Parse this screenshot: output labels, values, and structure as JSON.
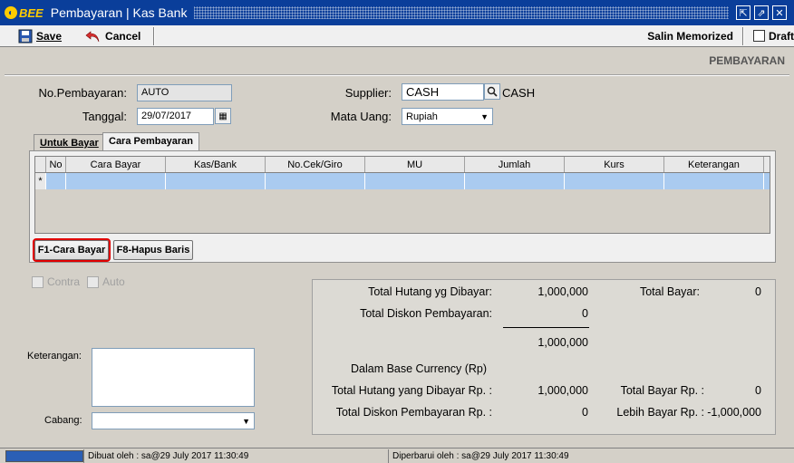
{
  "window": {
    "logo": "BEE",
    "title": "Pembayaran | Kas Bank"
  },
  "toolbar": {
    "save_label": "Save",
    "cancel_label": "Cancel",
    "salin_label": "Salin Memorized",
    "draft_label": "Draft"
  },
  "page_header": "PEMBAYARAN",
  "form": {
    "no_pembayaran_label": "No.Pembayaran:",
    "no_pembayaran_value": "AUTO",
    "tanggal_label": "Tanggal:",
    "tanggal_value": "29/07/2017",
    "supplier_label": "Supplier:",
    "supplier_value": "CASH",
    "supplier_name": "CASH",
    "mata_uang_label": "Mata Uang:",
    "mata_uang_value": "Rupiah"
  },
  "tabs": [
    {
      "label": "Untuk Bayar"
    },
    {
      "label": "Cara Pembayaran"
    }
  ],
  "grid": {
    "columns": [
      "",
      "No",
      "Cara Bayar",
      "Kas/Bank",
      "No.Cek/Giro",
      "MU",
      "Jumlah",
      "Kurs",
      "Keterangan"
    ],
    "new_row_marker": "*"
  },
  "buttons": {
    "f1": "F1-Cara Bayar",
    "f8": "F8-Hapus Baris"
  },
  "options": {
    "contra": "Contra",
    "auto": "Auto"
  },
  "lower": {
    "keterangan_label": "Keterangan:",
    "cabang_label": "Cabang:"
  },
  "summary": {
    "total_hutang_label": "Total Hutang yg Dibayar:",
    "total_hutang_value": "1,000,000",
    "total_diskon_label": "Total Diskon Pembayaran:",
    "total_diskon_value": "0",
    "subtotal_value": "1,000,000",
    "total_bayar_label": "Total Bayar:",
    "total_bayar_value": "0",
    "base_currency_label": "Dalam Base Currency (Rp)",
    "total_hutang_rp_label": "Total Hutang yang Dibayar Rp. :",
    "total_hutang_rp_value": "1,000,000",
    "total_diskon_rp_label": "Total Diskon Pembayaran Rp. :",
    "total_diskon_rp_value": "0",
    "total_bayar_rp_label": "Total Bayar Rp. :",
    "total_bayar_rp_value": "0",
    "lebih_bayar_rp_label": "Lebih Bayar Rp. :",
    "lebih_bayar_rp_value": "-1,000,000"
  },
  "status": {
    "dibuat": "Dibuat oleh : sa@29 July 2017  11:30:49",
    "diperbarui": "Diperbarui oleh : sa@29 July 2017  11:30:49"
  },
  "colors": {
    "title_bar": "#0a3e9a",
    "selected_row": "#aacbf0",
    "focus_outline": "#e00000"
  }
}
